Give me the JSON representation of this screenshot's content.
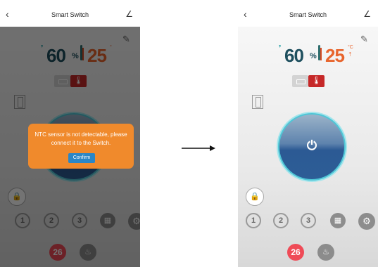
{
  "left_screen": {
    "title": "Smart Switch",
    "back_glyph": "‹",
    "edit_glyph": "∠",
    "humidity": "60",
    "humidity_unit": "%",
    "temperature": "25",
    "temperature_unit": "°",
    "dialog": {
      "message": "NTC sensor is not detectable, please connect it to the Switch.",
      "confirm_label": "Confirm"
    },
    "timers": [
      "1",
      "2",
      "3"
    ],
    "set_temp": "26"
  },
  "right_screen": {
    "title": "Smart Switch",
    "back_glyph": "‹",
    "edit_glyph": "∠",
    "humidity": "60",
    "humidity_unit": "%",
    "temperature": "25",
    "temperature_unit": "°C",
    "timers": [
      "1",
      "2",
      "3"
    ],
    "set_temp": "26"
  },
  "icons": [
    "back-icon",
    "edit-icon",
    "notes-icon",
    "door-icon",
    "lock-icon",
    "power-icon",
    "timer-icon",
    "calendar-icon",
    "settings-icon",
    "heating-icon",
    "arrow-right-icon"
  ],
  "colors": {
    "dialog_orange": "#f08a2c",
    "confirm_blue": "#2a86c6",
    "humidity_teal": "#1e4f5e",
    "temperature_orange": "#e8652d",
    "power_blue": "#2c5a94",
    "badge_red": "#ef4b57"
  }
}
